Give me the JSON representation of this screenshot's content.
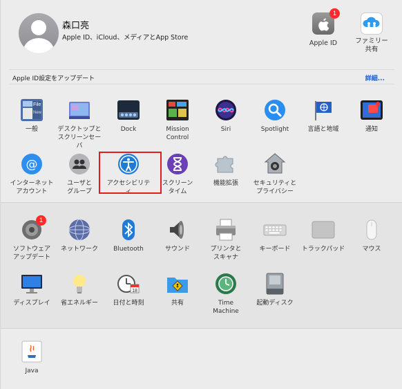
{
  "account": {
    "name": "森口亮",
    "subtitle": "Apple ID、iCloud、メディアとApp Store",
    "apple_id_label": "Apple ID",
    "apple_id_badge": "1",
    "family_label": "ファミリー\n共有"
  },
  "update_bar": {
    "text": "Apple ID設定をアップデート",
    "link": "詳細..."
  },
  "row1": [
    {
      "label": "一般",
      "icon": "general-icon"
    },
    {
      "label": "デスクトップと\nスクリーンセーバ",
      "icon": "desktop-icon"
    },
    {
      "label": "Dock",
      "icon": "dock-icon"
    },
    {
      "label": "Mission\nControl",
      "icon": "mission-control-icon"
    },
    {
      "label": "Siri",
      "icon": "siri-icon"
    },
    {
      "label": "Spotlight",
      "icon": "spotlight-icon"
    },
    {
      "label": "言語と地域",
      "icon": "language-icon"
    },
    {
      "label": "通知",
      "icon": "notifications-icon"
    }
  ],
  "row2": [
    {
      "label": "インターネット\nアカウント",
      "icon": "internet-accounts-icon"
    },
    {
      "label": "ユーザと\nグループ",
      "icon": "users-icon"
    },
    {
      "label": "アクセシビリティ",
      "icon": "accessibility-icon"
    },
    {
      "label": "スクリーン\nタイム",
      "icon": "screen-time-icon"
    },
    {
      "label": "機能拡張",
      "icon": "extensions-icon"
    },
    {
      "label": "セキュリティと\nプライバシー",
      "icon": "security-icon"
    }
  ],
  "row3": [
    {
      "label": "ソフトウェア\nアップデート",
      "icon": "software-update-icon",
      "badge": "1"
    },
    {
      "label": "ネットワーク",
      "icon": "network-icon"
    },
    {
      "label": "Bluetooth",
      "icon": "bluetooth-icon"
    },
    {
      "label": "サウンド",
      "icon": "sound-icon"
    },
    {
      "label": "プリンタと\nスキャナ",
      "icon": "printer-icon"
    },
    {
      "label": "キーボード",
      "icon": "keyboard-icon"
    },
    {
      "label": "トラックパッド",
      "icon": "trackpad-icon"
    },
    {
      "label": "マウス",
      "icon": "mouse-icon"
    }
  ],
  "row4": [
    {
      "label": "ディスプレイ",
      "icon": "display-icon"
    },
    {
      "label": "省エネルギー",
      "icon": "energy-saver-icon"
    },
    {
      "label": "日付と時刻",
      "icon": "date-time-icon"
    },
    {
      "label": "共有",
      "icon": "sharing-icon"
    },
    {
      "label": "Time\nMachine",
      "icon": "time-machine-icon"
    },
    {
      "label": "起動ディスク",
      "icon": "startup-disk-icon"
    }
  ],
  "row5": [
    {
      "label": "Java",
      "icon": "java-icon"
    }
  ],
  "colors": {
    "highlight": "#e21b1b",
    "link": "#1a5fd0",
    "badge": "#ff2a2a"
  }
}
